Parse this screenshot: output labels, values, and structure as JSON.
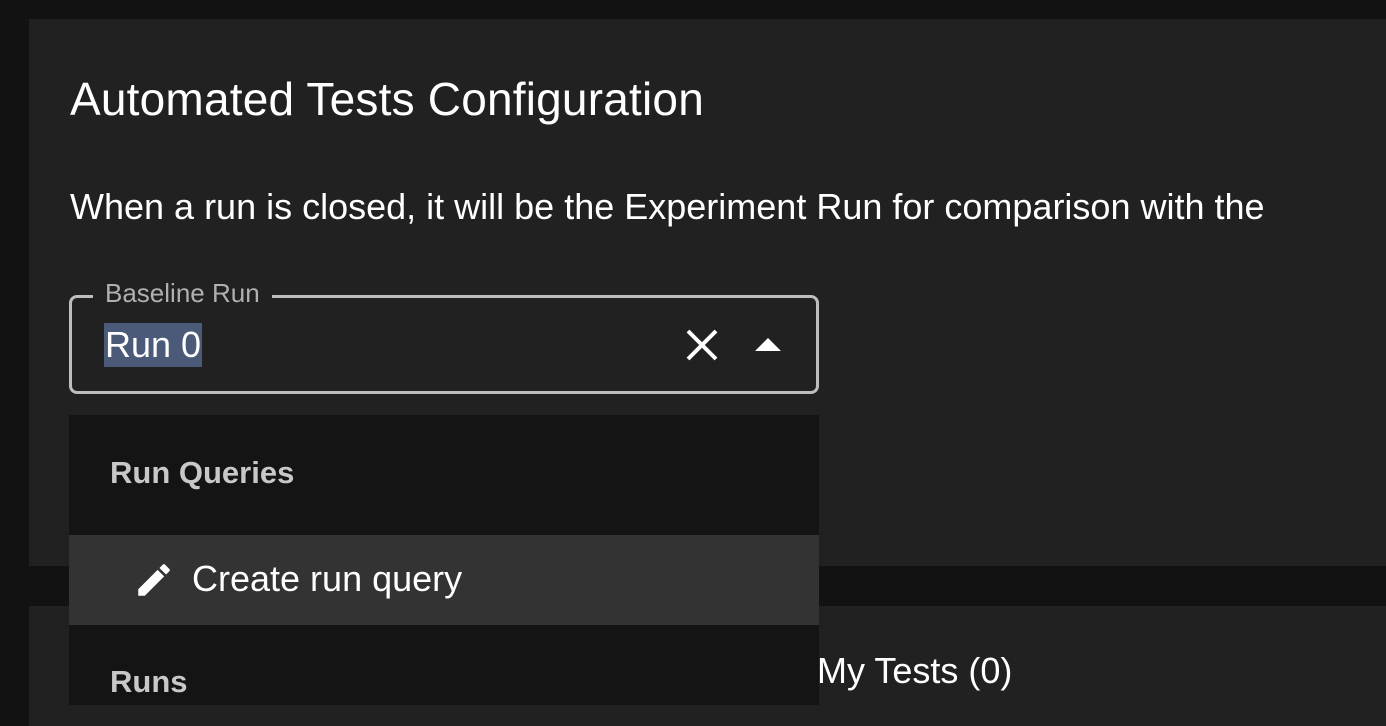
{
  "page": {
    "title": "Automated Tests Configuration",
    "description": "When a run is closed, it will be the Experiment Run for comparison with the"
  },
  "baseline_field": {
    "label": "Baseline Run",
    "value": "Run 0",
    "clear_icon": "close-icon",
    "toggle_icon": "arrow-up-icon"
  },
  "dropdown": {
    "groups": [
      {
        "header": "Run Queries",
        "options": [
          {
            "label": "Create run query",
            "icon": "pencil-icon",
            "highlighted": true
          }
        ]
      },
      {
        "header": "Runs",
        "options": []
      }
    ]
  },
  "tests_section": {
    "label": "My Tests (0)"
  },
  "colors": {
    "background": "#121212",
    "card": "#212121",
    "menu": "#141414",
    "highlight": "#333333",
    "selection": "#4b5a78",
    "border": "#bdbdbd"
  }
}
